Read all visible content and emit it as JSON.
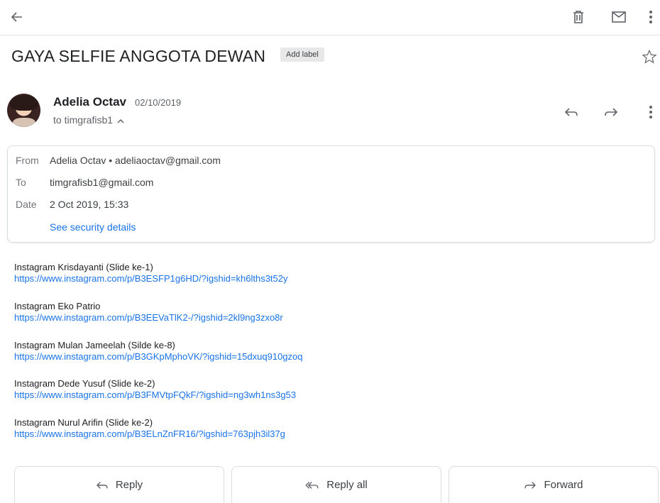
{
  "topbar": {
    "back_icon": "arrow-left-icon",
    "delete_icon": "trash-icon",
    "mark_unread_icon": "envelope-icon",
    "more_icon": "more-vert-icon"
  },
  "subject": {
    "title": "GAYA SELFIE ANGGOTA DEWAN",
    "label_chip": "Add label",
    "star_icon": "star-outline-icon"
  },
  "message": {
    "sender_name": "Adelia Octav",
    "date": "02/10/2019",
    "to_line": "to timgrafisb1"
  },
  "details": {
    "from_label": "From",
    "from_value": "Adelia Octav • adeliaoctav@gmail.com",
    "to_label": "To",
    "to_value": "timgrafisb1@gmail.com",
    "date_label": "Date",
    "date_value": "2 Oct 2019, 15:33",
    "security_link": "See security details"
  },
  "body": {
    "items": [
      {
        "title": "Instagram Krisdayanti (Slide ke-1)",
        "url": "https://www.instagram.com/p/B3ESFP1g6HD/?igshid=kh6lths3t52y"
      },
      {
        "title": "Instagram Eko Patrio",
        "url": "https://www.instagram.com/p/B3EEVaTlK2-/?igshid=2kl9ng3zxo8r"
      },
      {
        "title": "Instagram Mulan Jameelah (Silde ke-8)",
        "url": "https://www.instagram.com/p/B3GKpMphoVK/?igshid=15dxuq910gzoq"
      },
      {
        "title": "Instagram Dede Yusuf (Slide ke-2)",
        "url": "https://www.instagram.com/p/B3FMVtpFQkF/?igshid=ng3wh1ns3g53"
      },
      {
        "title": "Instagram Nurul Arifin (Slide ke-2)",
        "url": "https://www.instagram.com/p/B3ELnZnFR16/?igshid=763pjh3il37g"
      }
    ]
  },
  "actions": {
    "reply": "Reply",
    "reply_all": "Reply all",
    "forward": "Forward"
  },
  "colors": {
    "link": "#1a73e8",
    "icon": "#5f6368",
    "border": "#dadce0"
  }
}
